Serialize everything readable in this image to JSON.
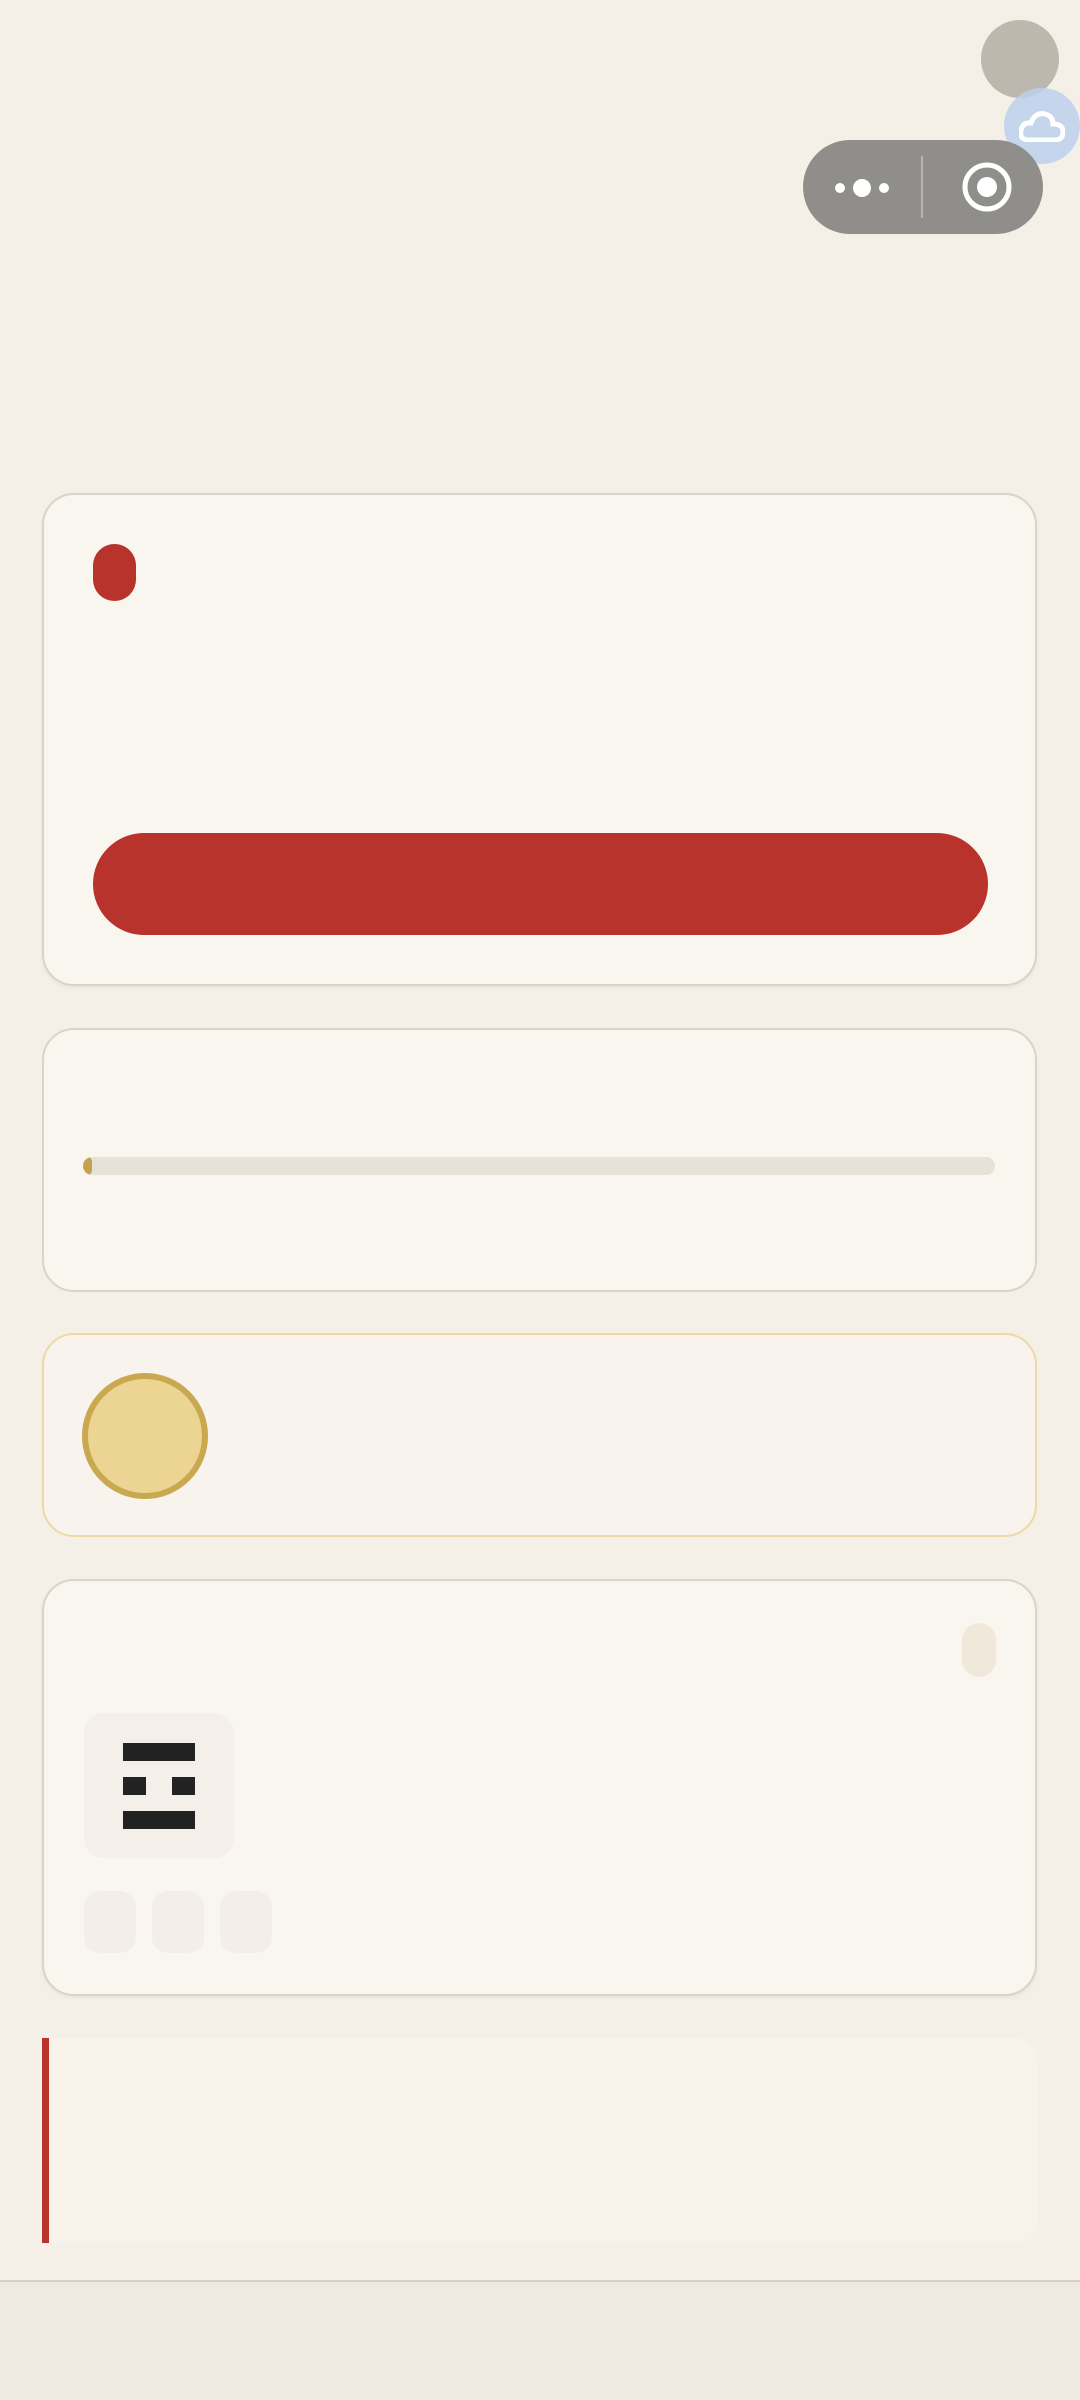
{
  "colors": {
    "background": "#f4f0e7",
    "card": "#f9f5ef",
    "accent_red": "#b7332b",
    "accent_gold": "#c4a24f",
    "coin_fill": "#ecd492",
    "capsule": "#8f8e8b"
  },
  "icons": {
    "avatar": "avatar-circle",
    "cloud": "cloud-icon",
    "more": "more-dots-icon",
    "close": "target-close-icon",
    "hexagram": "hexagram-icon"
  },
  "main_card": {
    "action_label": ""
  },
  "progress": {
    "value": 0.01
  },
  "hexagram": {
    "lines": [
      "yang",
      "yin",
      "yang"
    ]
  }
}
